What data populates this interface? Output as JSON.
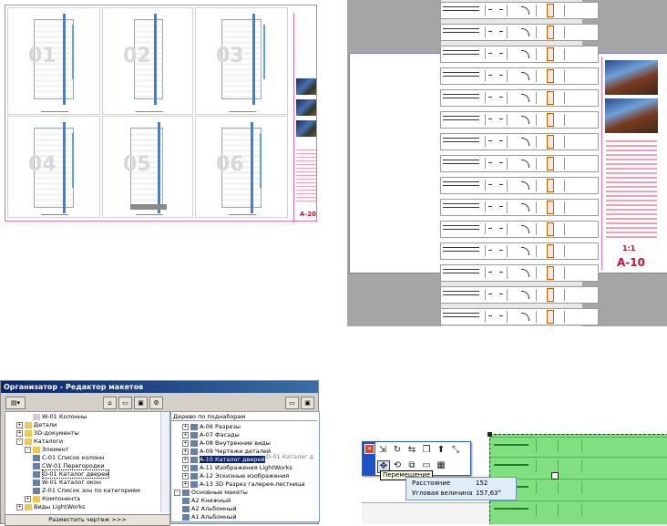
{
  "layout_sheet_1": {
    "cell_numbers": [
      "01",
      "02",
      "03",
      "04",
      "05",
      "06"
    ],
    "sheet_id": "A-20"
  },
  "layout_sheet_2": {
    "scale": "1:1",
    "sheet_id": "A-10"
  },
  "organizer": {
    "title": "Организатор - Редактор макетов",
    "left_tree": [
      {
        "label": "W-01 Колонны",
        "indent": 3,
        "icon": "pencil-icon"
      },
      {
        "label": "Детали",
        "indent": 1,
        "icon": "folder-icon",
        "expander": "+"
      },
      {
        "label": "3D-документы",
        "indent": 1,
        "icon": "folder-icon",
        "expander": "+"
      },
      {
        "label": "Каталоги",
        "indent": 1,
        "icon": "folder-icon",
        "expander": "-"
      },
      {
        "label": "Элемент",
        "indent": 2,
        "icon": "folder-icon",
        "expander": "-"
      },
      {
        "label": "C-01 Список колонн",
        "indent": 3,
        "icon": ""
      },
      {
        "label": "CW-01 Перегородки",
        "indent": 3,
        "icon": ""
      },
      {
        "label": "D-01 Каталог дверей",
        "indent": 3,
        "icon": "",
        "selected": true
      },
      {
        "label": "W-01 Каталог окон",
        "indent": 3,
        "icon": ""
      },
      {
        "label": "Z-01 Список зон по категориям",
        "indent": 3,
        "icon": ""
      },
      {
        "label": "Компонента",
        "indent": 2,
        "icon": "folder-icon",
        "expander": "+"
      },
      {
        "label": "Виды LightWorks",
        "indent": 1,
        "icon": "folder-icon",
        "expander": "+"
      }
    ],
    "right_combo": "Дерево по поднаборам",
    "right_tree": [
      {
        "label": "A-06 Разрезы",
        "indent": 1,
        "expander": "+"
      },
      {
        "label": "A-07 Фасады",
        "indent": 1,
        "expander": "+"
      },
      {
        "label": "A-08 Внутренние виды",
        "indent": 1,
        "expander": "+"
      },
      {
        "label": "A-09 Чертежи деталей",
        "indent": 1,
        "expander": "+"
      },
      {
        "label": "A-10 Каталог дверей",
        "indent": 1,
        "expander": "+",
        "highlight": true
      },
      {
        "label": "A-11 Изображения LightWorks",
        "indent": 1,
        "expander": "+"
      },
      {
        "label": "A-12 Эскизные изображения",
        "indent": 1,
        "expander": "+"
      },
      {
        "label": "A-13 3D Разрез галерея-лестница",
        "indent": 1,
        "expander": "+"
      },
      {
        "label": "Основные макеты",
        "indent": 0,
        "expander": "-"
      },
      {
        "label": "A2 Книжный",
        "indent": 1
      },
      {
        "label": "A2 Альбомный",
        "indent": 1
      },
      {
        "label": "A1 Альбомный",
        "indent": 1
      }
    ],
    "drag_ghost": "D-01 Каталог д",
    "place_button": "Разместить чертеж >>>"
  },
  "pet_palette": {
    "tooltip": "Перемещение",
    "tracker_rows": [
      {
        "label": "Расстояние",
        "value": "152"
      },
      {
        "label": "Угловая величина",
        "value": "157,63°"
      }
    ]
  }
}
